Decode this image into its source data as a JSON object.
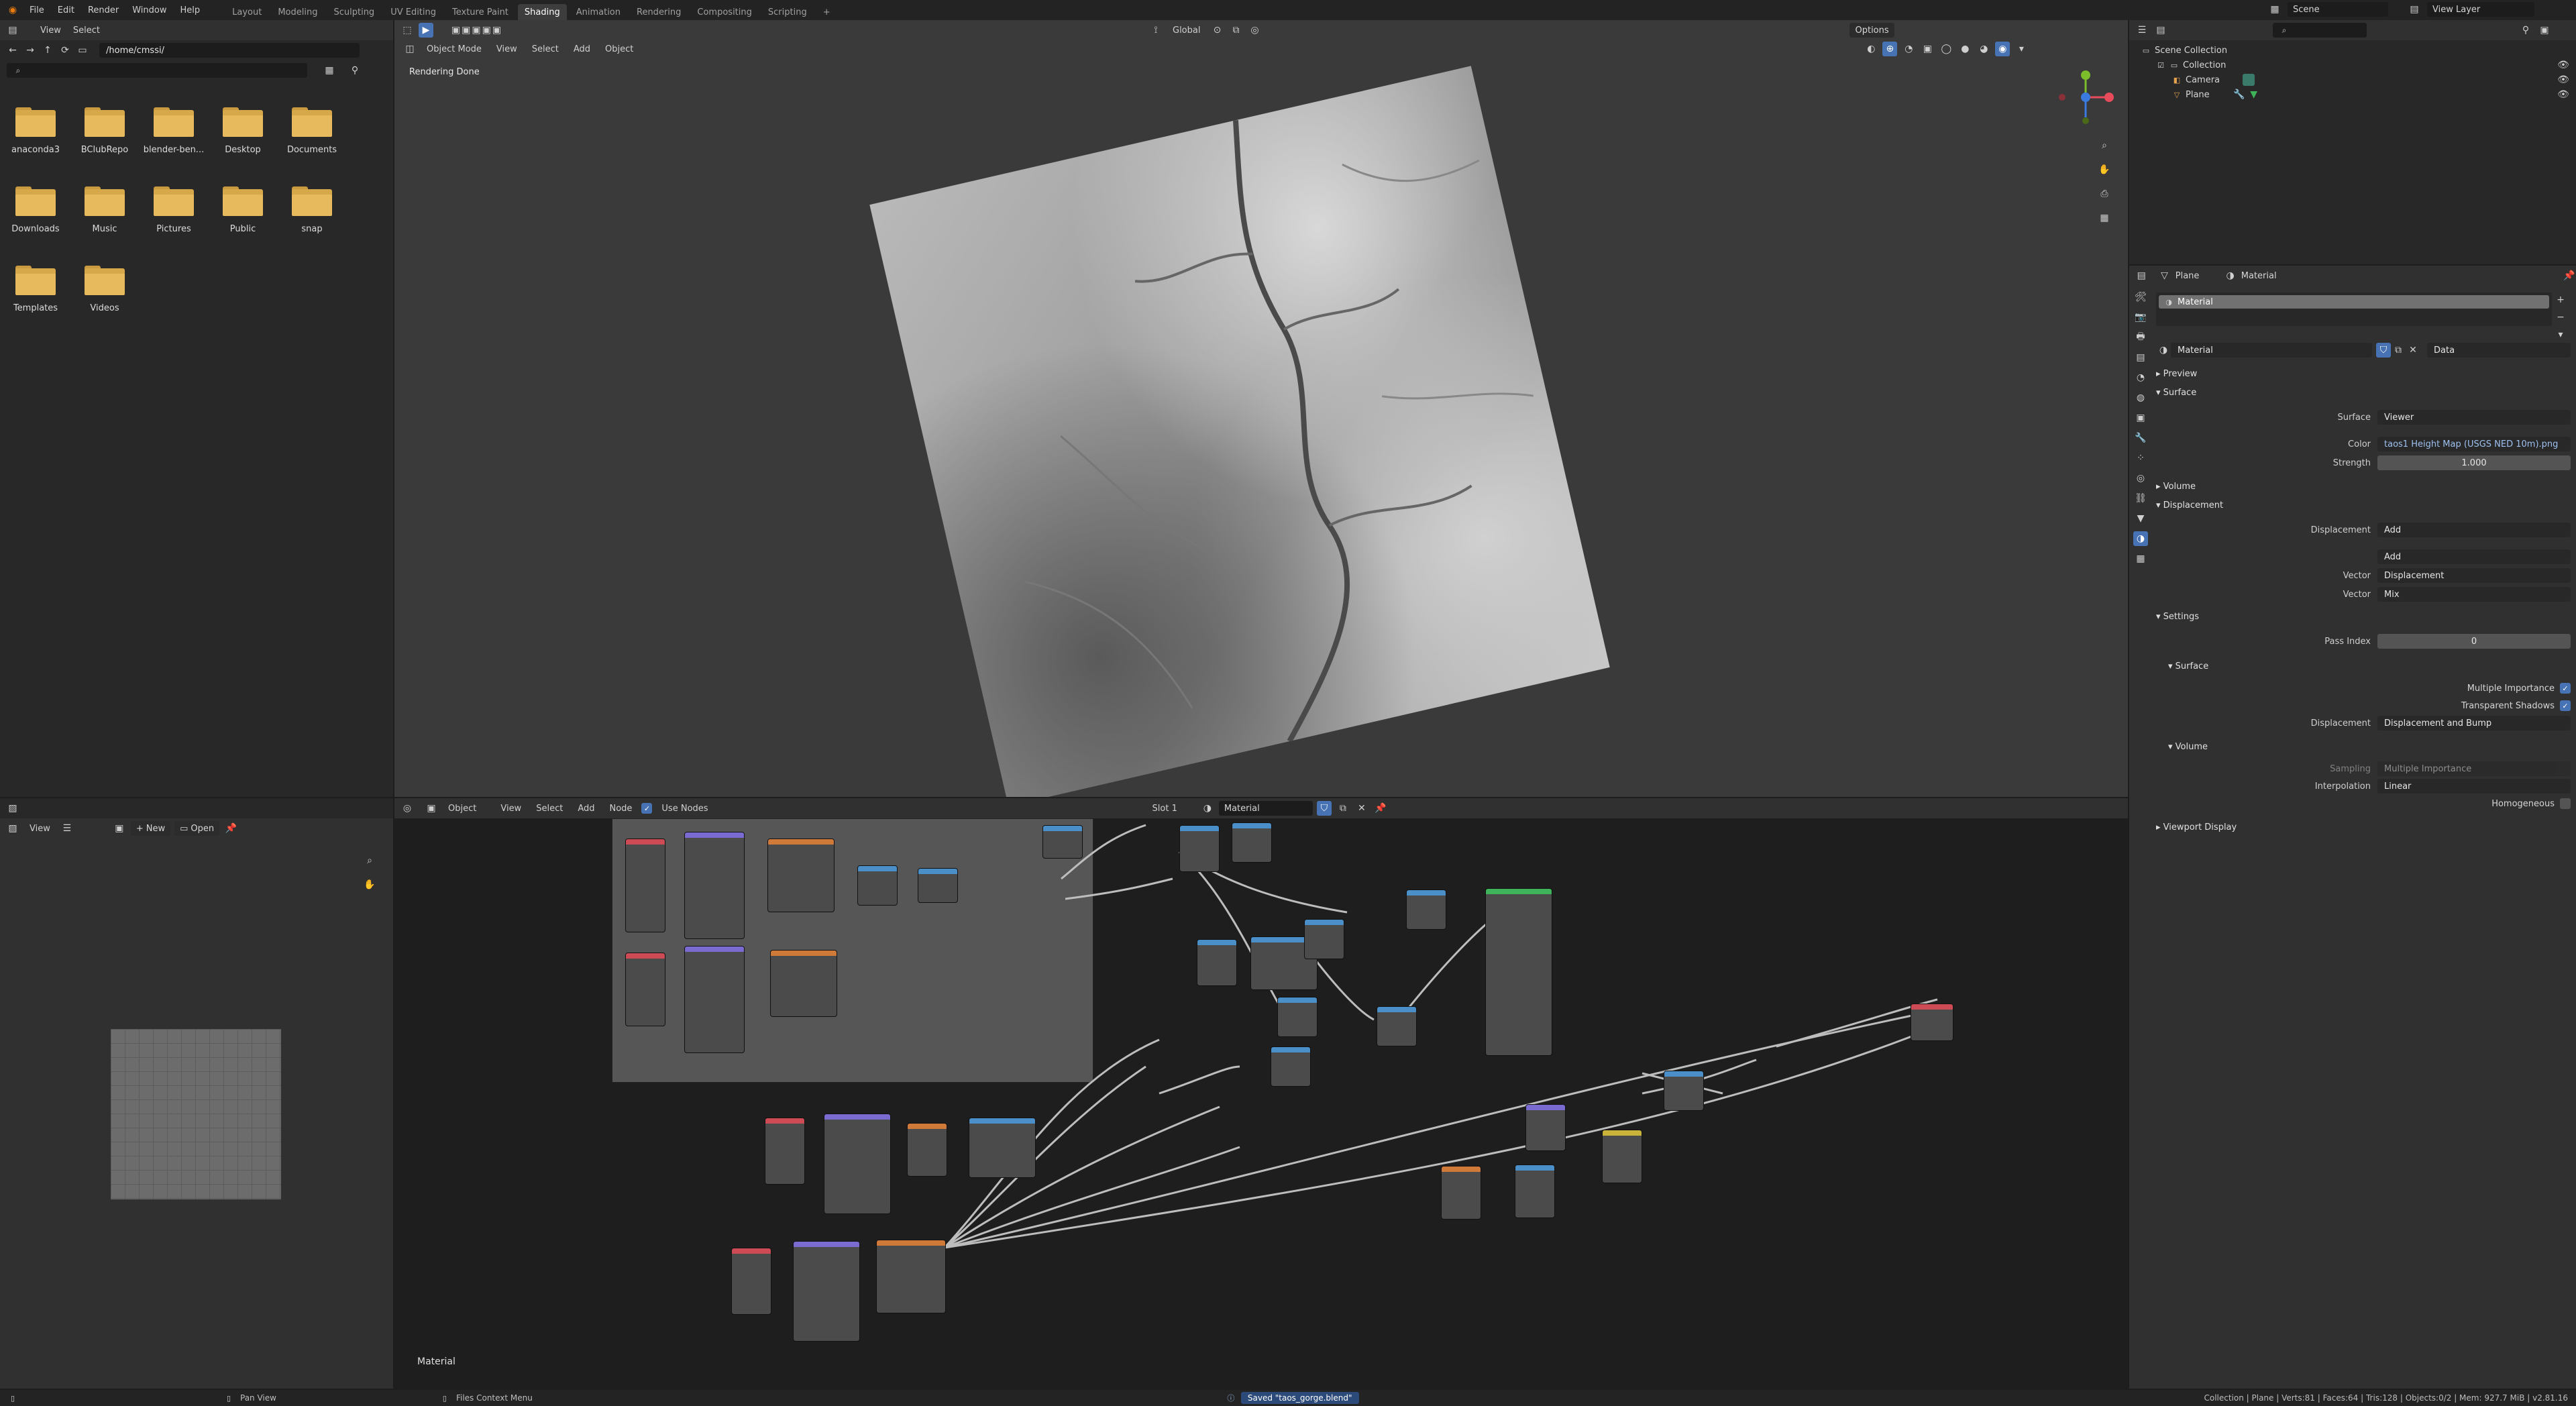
{
  "menu": {
    "items": [
      "File",
      "Edit",
      "Render",
      "Window",
      "Help"
    ],
    "workspaces": [
      "Layout",
      "Modeling",
      "Sculpting",
      "UV Editing",
      "Texture Paint",
      "Shading",
      "Animation",
      "Rendering",
      "Compositing",
      "Scripting"
    ],
    "active_workspace": "Shading",
    "add_tab": "+"
  },
  "scene": {
    "name": "Scene",
    "view_layer": "View Layer"
  },
  "filebrowser": {
    "menu": [
      "View",
      "Select"
    ],
    "path": "/home/cmssi/",
    "search_placeholder": "",
    "folders": [
      {
        "label": "anaconda3"
      },
      {
        "label": "BClubRepo"
      },
      {
        "label": "blender-ben..."
      },
      {
        "label": "Desktop"
      },
      {
        "label": "Documents"
      },
      {
        "label": "Downloads"
      },
      {
        "label": "Music"
      },
      {
        "label": "Pictures"
      },
      {
        "label": "Public"
      },
      {
        "label": "snap"
      },
      {
        "label": "Templates"
      },
      {
        "label": "Videos"
      }
    ]
  },
  "viewport": {
    "mode": "Object Mode",
    "menu": [
      "View",
      "Select",
      "Add",
      "Object"
    ],
    "transform_orientation": "Global",
    "options_label": "Options",
    "status_text": "Rendering Done"
  },
  "imageeditor": {
    "view_label": "View",
    "new_label": "New",
    "open_label": "Open"
  },
  "nodeeditor": {
    "object_label": "Object",
    "menu": [
      "View",
      "Select",
      "Add",
      "Node"
    ],
    "use_nodes_label": "Use Nodes",
    "slot_label": "Slot 1",
    "material_name": "Material",
    "footer_label": "Material"
  },
  "outliner": {
    "search_placeholder": "",
    "items": [
      {
        "label": "Scene Collection",
        "indent": 0
      },
      {
        "label": "Collection",
        "indent": 1
      },
      {
        "label": "Camera",
        "indent": 2
      },
      {
        "label": "Plane",
        "indent": 2
      }
    ]
  },
  "properties": {
    "breadcrumb_object": "Plane",
    "breadcrumb_material": "Material",
    "slot_item": "Material",
    "material_name": "Material",
    "link_label": "Data",
    "sections": {
      "preview": "Preview",
      "surface": "Surface",
      "volume": "Volume",
      "displacement": "Displacement",
      "settings": "Settings",
      "settings_surface": "Surface",
      "settings_volume": "Volume",
      "viewport_display": "Viewport Display"
    },
    "surface_label": "Surface",
    "surface_value": "Viewer",
    "color_label": "Color",
    "color_value": "taos1 Height Map (USGS NED 10m).png",
    "strength_label": "Strength",
    "strength_value": "1.000",
    "displacement_label": "Displacement",
    "displacement_value": "Add",
    "add_value": "Add",
    "vector1_label": "Vector",
    "vector1_value": "Displacement",
    "vector2_label": "Vector",
    "vector2_value": "Mix",
    "pass_index_label": "Pass Index",
    "pass_index_value": "0",
    "multiple_importance_label": "Multiple Importance",
    "transparent_shadows_label": "Transparent Shadows",
    "settings_displacement_label": "Displacement",
    "settings_displacement_value": "Displacement and Bump",
    "sampling_label": "Sampling",
    "sampling_value": "Multiple Importance",
    "interpolation_label": "Interpolation",
    "interpolation_value": "Linear",
    "homogeneous_label": "Homogeneous"
  },
  "statusbar": {
    "pan_view": "Pan View",
    "context_menu": "Files Context Menu",
    "saved_message": "Saved \"taos_gorge.blend\"",
    "stats": "Collection | Plane | Verts:81 | Faces:64 | Tris:128 | Objects:0/2 | Mem: 927.7 MiB | v2.81.16"
  },
  "colors": {
    "accent": "#4772b3",
    "folder": "#e7bb5d",
    "node_shader": "#7a6bd0",
    "node_input": "#cc4b55",
    "node_texture": "#d07a3a",
    "node_vector": "#4b8fc9",
    "node_output": "#3fb35a"
  }
}
